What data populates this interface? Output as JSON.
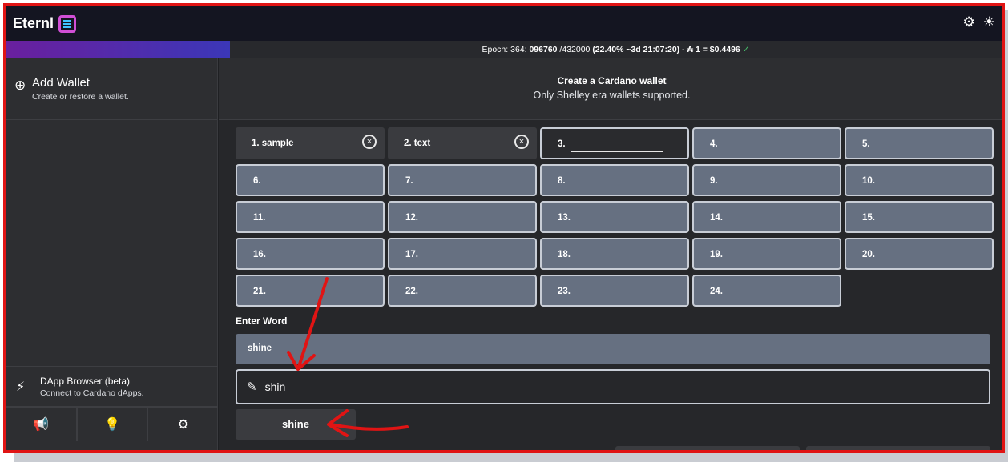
{
  "app": {
    "title": "Eternl"
  },
  "epoch": {
    "prefix": "Epoch: 364: ",
    "slot": "096760",
    "total": " /432000 ",
    "detail": "(22.40% ~3d 21:07:20) · ₳ 1 = $0.4496",
    "check": "✓"
  },
  "sidebar": {
    "add_wallet": {
      "title": "Add Wallet",
      "subtitle": "Create or restore a wallet."
    },
    "dapp": {
      "title": "DApp Browser (beta)",
      "subtitle": "Connect to Cardano dApps."
    }
  },
  "main": {
    "title": "Create a Cardano wallet",
    "subtitle": "Only Shelley era wallets supported."
  },
  "words": [
    {
      "label": "1. sample"
    },
    {
      "label": "2. text"
    },
    {
      "label": "3."
    },
    {
      "label": "4."
    },
    {
      "label": "5."
    },
    {
      "label": "6."
    },
    {
      "label": "7."
    },
    {
      "label": "8."
    },
    {
      "label": "9."
    },
    {
      "label": "10."
    },
    {
      "label": "11."
    },
    {
      "label": "12."
    },
    {
      "label": "13."
    },
    {
      "label": "14."
    },
    {
      "label": "15."
    },
    {
      "label": "16."
    },
    {
      "label": "17."
    },
    {
      "label": "18."
    },
    {
      "label": "19."
    },
    {
      "label": "20."
    },
    {
      "label": "21."
    },
    {
      "label": "22."
    },
    {
      "label": "23."
    },
    {
      "label": "24."
    }
  ],
  "enter_word": {
    "label": "Enter Word",
    "selected": "shine",
    "input_value": "shin",
    "suggestion": "shine"
  },
  "icons": {
    "add_wallet": "wallet-plus-icon",
    "dapp": "plug-icon",
    "megaphone": "megaphone-icon",
    "bulb": "lightbulb-icon",
    "settings": "gear-icon",
    "network": "network-icon",
    "theme": "sun-icon",
    "edit": "pencil-icon",
    "clear": "close-circle-icon"
  },
  "colors": {
    "annotation": "#e01414"
  }
}
